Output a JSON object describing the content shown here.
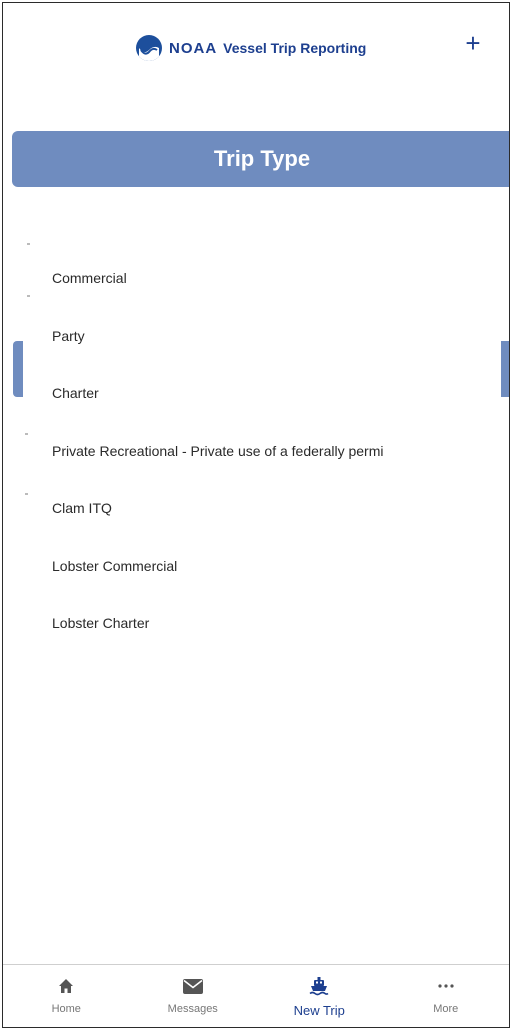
{
  "header": {
    "brand_noaa": "NOAA",
    "brand_text": "Vessel Trip Reporting",
    "add_icon": "plus-icon"
  },
  "title": "Trip Type",
  "trip_types": [
    "Commercial",
    "Party",
    "Charter",
    "Private Recreational - Private use of a federally permi",
    "Clam ITQ",
    "Lobster Commercial",
    "Lobster Charter"
  ],
  "tabs": [
    {
      "label": "Home",
      "icon": "home-icon"
    },
    {
      "label": "Messages",
      "icon": "envelope-icon"
    },
    {
      "label": "New Trip",
      "icon": "boat-icon",
      "active": true
    },
    {
      "label": "More",
      "icon": "more-icon"
    }
  ],
  "colors": {
    "accent": "#6f8cbf",
    "brand": "#1d3f8f",
    "tab_inactive": "#777777"
  }
}
